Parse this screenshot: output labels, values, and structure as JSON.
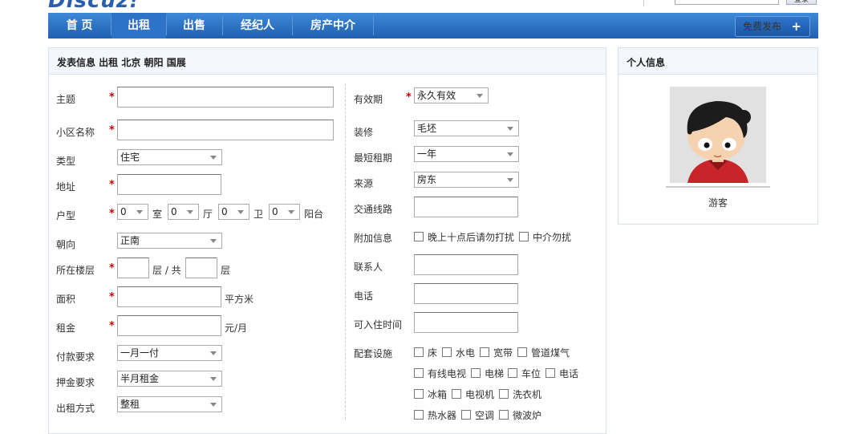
{
  "logo_text": "Discuz!",
  "top": {
    "search_button": "登录"
  },
  "nav": {
    "items": [
      "首 页",
      "出租",
      "出售",
      "经纪人",
      "房产中介"
    ],
    "active": "出租",
    "publish_button": "免费发布",
    "publish_icon": "plus-icon"
  },
  "form_panel": {
    "title": "发表信息 出租 北京 朝阳 国展"
  },
  "side_panel": {
    "title": "个人信息",
    "username": "游客"
  },
  "left_form": {
    "subject": {
      "label": "主题",
      "value": ""
    },
    "community": {
      "label": "小区名称",
      "value": ""
    },
    "type": {
      "label": "类型",
      "value": "住宅"
    },
    "address": {
      "label": "地址",
      "value": ""
    },
    "layout": {
      "label": "户型",
      "room_value": "0",
      "room_unit": "室",
      "hall_value": "0",
      "hall_unit": "厅",
      "bath_value": "0",
      "bath_unit": "卫",
      "balcony_value": "0",
      "balcony_unit": "阳台"
    },
    "orientation": {
      "label": "朝向",
      "value": "正南"
    },
    "floor": {
      "label": "所在楼层",
      "unit_floor": "层 / 共",
      "unit_total": "层"
    },
    "area": {
      "label": "面积",
      "unit": "平方米"
    },
    "rent": {
      "label": "租金",
      "unit": "元/月"
    },
    "payment": {
      "label": "付款要求",
      "value": "一月一付"
    },
    "deposit": {
      "label": "押金要求",
      "value": "半月租金"
    },
    "rent_method": {
      "label": "出租方式",
      "value": "整租"
    }
  },
  "right_form": {
    "validity": {
      "label": "有效期",
      "value": "永久有效"
    },
    "decoration": {
      "label": "装修",
      "value": "毛坯"
    },
    "min_term": {
      "label": "最短租期",
      "value": "一年"
    },
    "source": {
      "label": "来源",
      "value": "房东"
    },
    "transport": {
      "label": "交通线路"
    },
    "extra": {
      "label": "附加信息",
      "options": [
        "晚上十点后请勿打扰",
        "中介勿扰"
      ]
    },
    "contact": {
      "label": "联系人"
    },
    "phone": {
      "label": "电话"
    },
    "move_in": {
      "label": "可入住时间"
    },
    "facilities": {
      "label": "配套设施",
      "options": [
        "床",
        "水电",
        "宽带",
        "管道煤气",
        "有线电视",
        "电梯",
        "车位",
        "电话",
        "冰箱",
        "电视机",
        "洗衣机",
        "热水器",
        "空调",
        "微波炉"
      ]
    }
  }
}
